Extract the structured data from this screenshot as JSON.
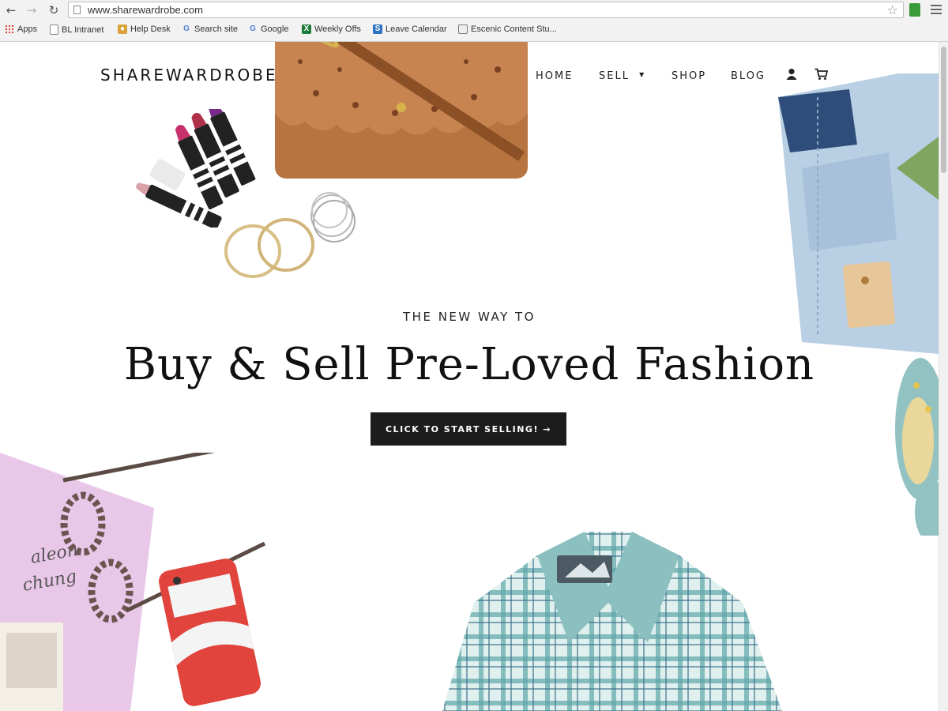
{
  "browser": {
    "url": "www.sharewardrobe.com",
    "bookmarks": [
      {
        "label": "Apps",
        "icon": "apps-grid-icon"
      },
      {
        "label": "BL Intranet",
        "icon": "page-icon"
      },
      {
        "label": "Help Desk",
        "icon": "helpdesk-icon"
      },
      {
        "label": "Search site",
        "icon": "google-icon"
      },
      {
        "label": "Google",
        "icon": "google-icon"
      },
      {
        "label": "Weekly Offs",
        "icon": "excel-icon"
      },
      {
        "label": "Leave Calendar",
        "icon": "sharepoint-icon"
      },
      {
        "label": "Escenic Content Stu...",
        "icon": "escenic-icon"
      }
    ]
  },
  "site": {
    "logo": "SHAREWARDROBE",
    "nav": {
      "home": "HOME",
      "sell": "SELL",
      "shop": "SHOP",
      "blog": "BLOG"
    },
    "hero": {
      "eyebrow": "THE NEW WAY TO",
      "headline": "Buy & Sell Pre-Loved Fashion",
      "cta": "CLICK TO START SELLING! →"
    }
  },
  "colors": {
    "cta_bg": "#1c1c1c",
    "bag_brown": "#b87440",
    "denim": "#b9cfe4",
    "plaid_teal": "#5fa5a8",
    "pink_card": "#e9c7e8",
    "phone_red": "#e0443c"
  }
}
